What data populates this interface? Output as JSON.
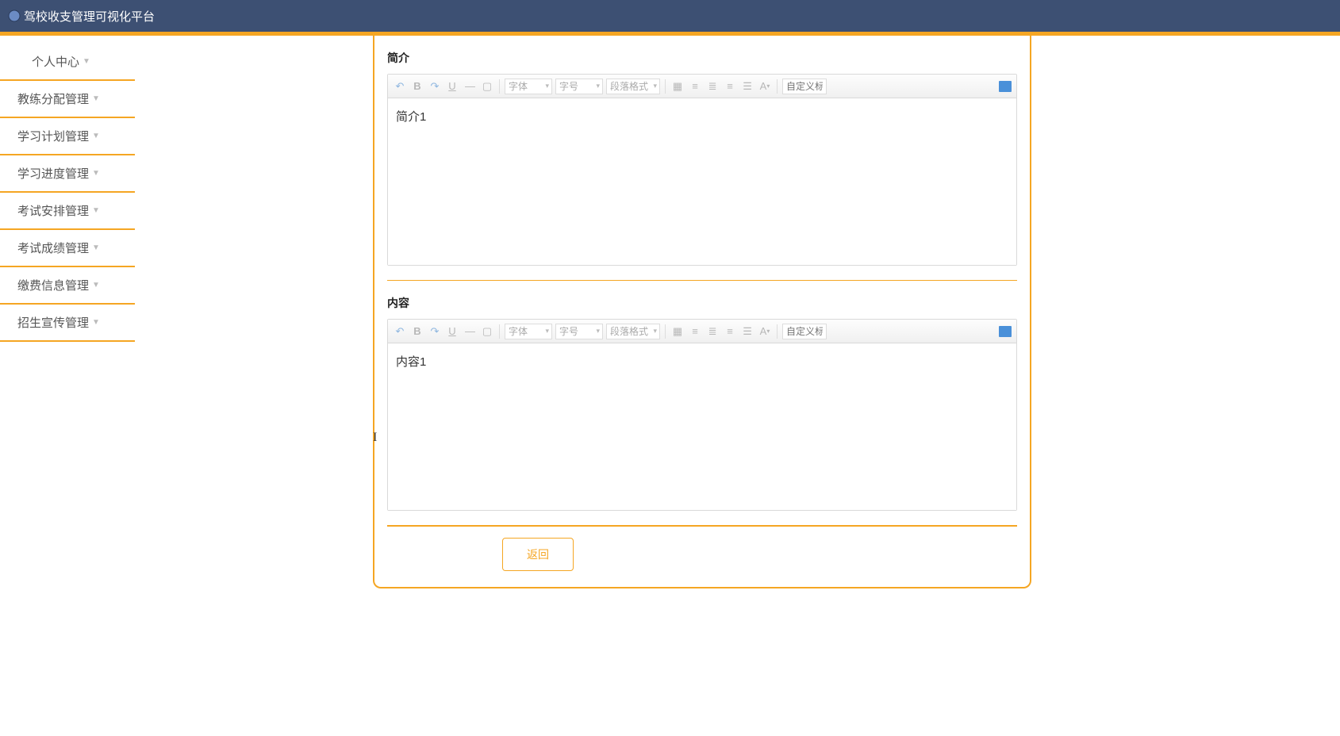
{
  "header": {
    "title": "驾校收支管理可视化平台"
  },
  "sidebar": {
    "items": [
      {
        "label": "个人中心"
      },
      {
        "label": "教练分配管理"
      },
      {
        "label": "学习计划管理"
      },
      {
        "label": "学习进度管理"
      },
      {
        "label": "考试安排管理"
      },
      {
        "label": "考试成绩管理"
      },
      {
        "label": "缴费信息管理"
      },
      {
        "label": "招生宣传管理"
      }
    ]
  },
  "editor_toolbar": {
    "font_family": "字体",
    "font_size": "字号",
    "paragraph": "段落格式",
    "custom_title": "自定义标题"
  },
  "sections": {
    "intro": {
      "label": "简介",
      "content": "简介1"
    },
    "content": {
      "label": "内容",
      "content": "内容1"
    }
  },
  "buttons": {
    "back": "返回"
  }
}
